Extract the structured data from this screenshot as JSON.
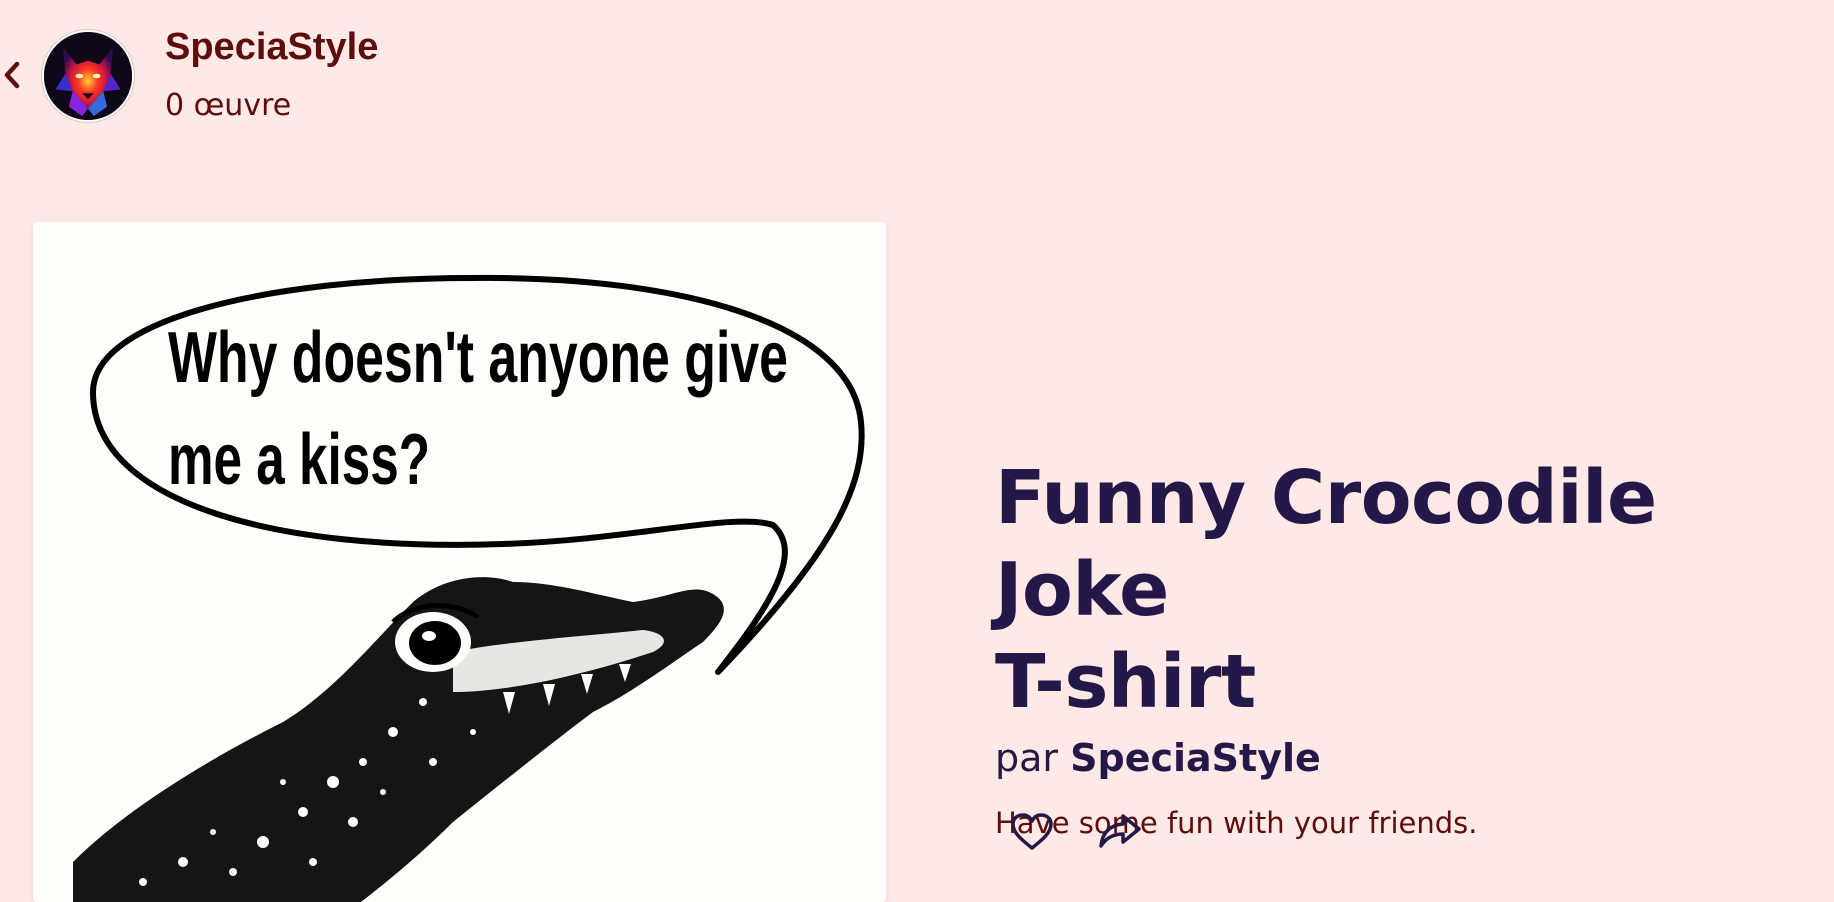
{
  "header": {
    "shop_name": "SpeciaStyle",
    "works_count": "0 œuvre",
    "back_icon": "chevron-left-icon",
    "avatar_icon": "wolf-avatar-icon"
  },
  "artwork": {
    "speech_line_1": "Why doesn't anyone give",
    "speech_line_2": "me a kiss?",
    "illustration": "crocodile-head-illustration"
  },
  "product": {
    "title_line_1": "Funny Crocodile Joke",
    "title_line_2": "T-shirt",
    "by_prefix": "par",
    "by_name": "SpeciaStyle",
    "description": "Have some fun with your friends."
  },
  "actions": {
    "like_icon": "heart-outline-icon",
    "share_icon": "share-arrow-icon"
  },
  "colors": {
    "background": "#ffe9e6",
    "brand_text": "#5e0d0d",
    "title_text": "#241849",
    "card_bg": "#fffdf9"
  }
}
